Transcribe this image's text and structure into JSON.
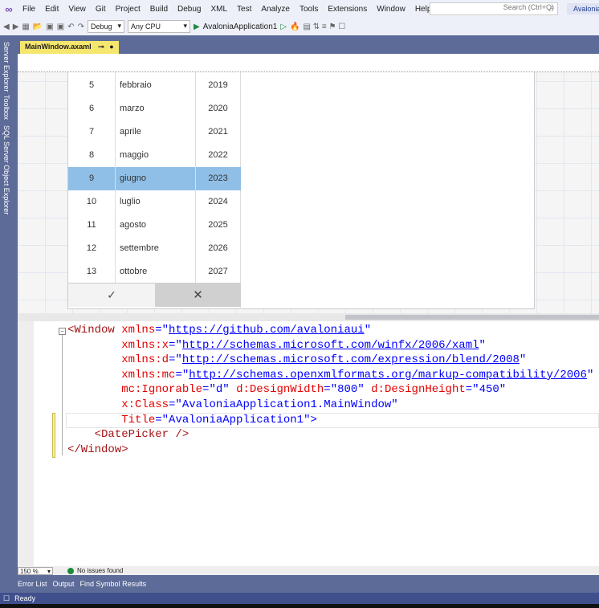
{
  "menu": {
    "items": [
      "File",
      "Edit",
      "View",
      "Git",
      "Project",
      "Build",
      "Debug",
      "XML",
      "Test",
      "Analyze",
      "Tools",
      "Extensions",
      "Window",
      "Help"
    ],
    "search_placeholder": "Search (Ctrl+Q)",
    "app_name": "Avalonia"
  },
  "toolbar": {
    "config": "Debug",
    "platform": "Any CPU",
    "run_target": "AvaloniaApplication1"
  },
  "tab": {
    "label": "MainWindow.axaml",
    "pin": "⊸",
    "modified": "●"
  },
  "sidebar": [
    "Server Explorer",
    "Toolbox",
    "SQL Server Object Explorer"
  ],
  "picker": {
    "rows": [
      {
        "day": "5",
        "month": "febbraio",
        "year": "2019"
      },
      {
        "day": "6",
        "month": "marzo",
        "year": "2020"
      },
      {
        "day": "7",
        "month": "aprile",
        "year": "2021"
      },
      {
        "day": "8",
        "month": "maggio",
        "year": "2022"
      },
      {
        "day": "9",
        "month": "giugno",
        "year": "2023",
        "selected": true
      },
      {
        "day": "10",
        "month": "luglio",
        "year": "2024"
      },
      {
        "day": "11",
        "month": "agosto",
        "year": "2025"
      },
      {
        "day": "12",
        "month": "settembre",
        "year": "2026"
      },
      {
        "day": "13",
        "month": "ottobre",
        "year": "2027"
      }
    ],
    "accept": "✓",
    "dismiss": "✕",
    "highlight_color": "#8fbfe7"
  },
  "code": {
    "l1a": "<Window",
    "l1b": "xmlns",
    "l1c": "https://github.com/avaloniaui",
    "l2b": "xmlns:x",
    "l2c": "http://schemas.microsoft.com/winfx/2006/xaml",
    "l3b": "xmlns:d",
    "l3c": "http://schemas.microsoft.com/expression/blend/2008",
    "l4b": "xmlns:mc",
    "l4c": "http://schemas.openxmlformats.org/markup-compatibility/2006",
    "l5b": "mc:Ignorable",
    "l5c": "d",
    "l5d": "d:DesignWidth",
    "l5e": "800",
    "l5f": "d:DesignHeight",
    "l5g": "450",
    "l6b": "x:Class",
    "l6c": "AvaloniaApplication1.MainWindow",
    "l7b": "Title",
    "l7c": "AvaloniaApplication1",
    "l8": "<DatePicker />",
    "l9": "</Window>"
  },
  "status": {
    "zoom": "150 %",
    "issues": "No issues found",
    "ready": "Ready"
  },
  "tooltabs": [
    "Error List",
    "Output",
    "Find Symbol Results"
  ]
}
